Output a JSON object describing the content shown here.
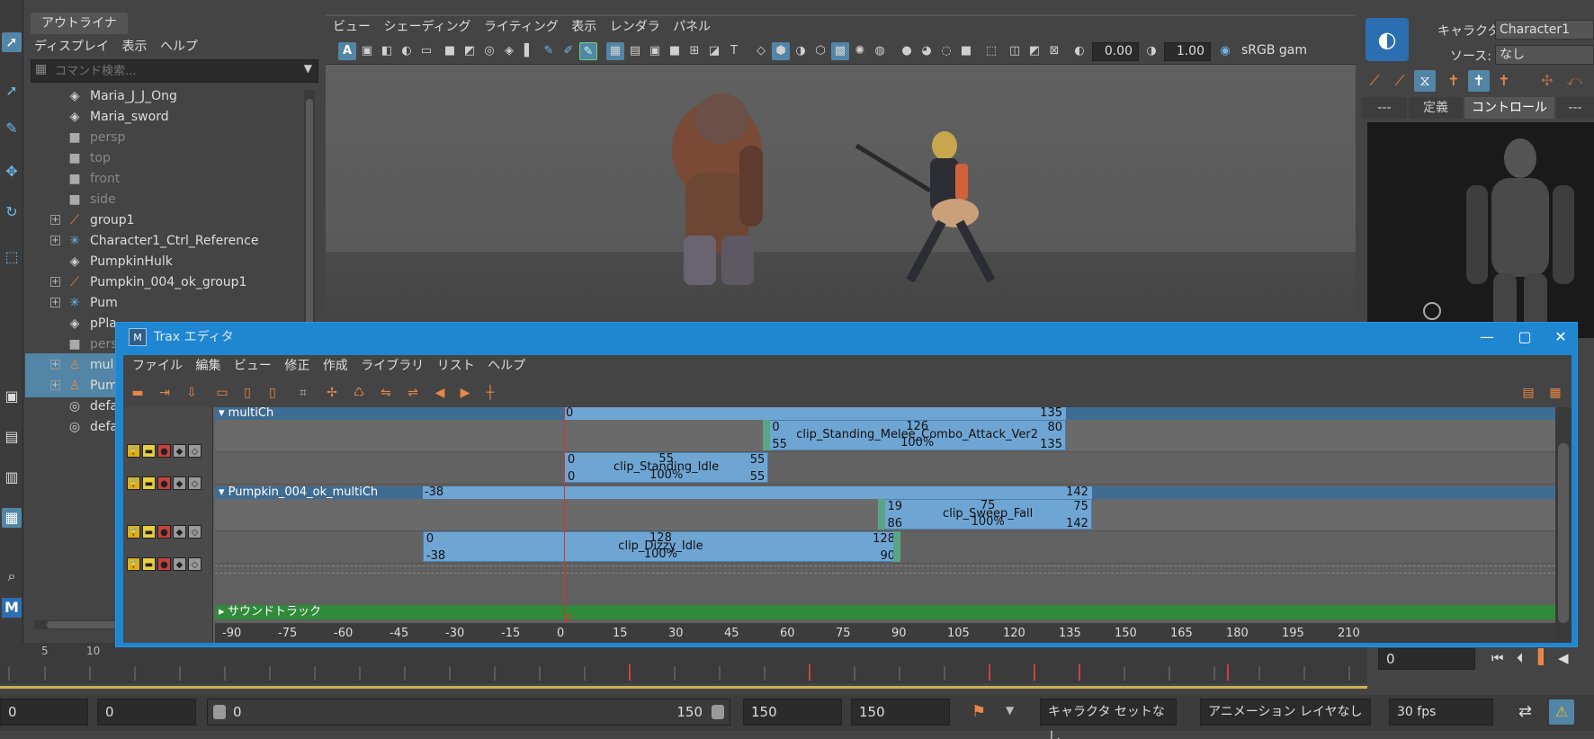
{
  "outliner": {
    "tab_label": "アウトライナ",
    "menu": [
      "ディスプレイ",
      "表示",
      "ヘルプ"
    ],
    "search_placeholder": "コマンド検索...",
    "items": [
      {
        "label": "Maria_J_J_Ong",
        "icon": "mesh-icon",
        "expandable": false,
        "dim": false,
        "selected": false
      },
      {
        "label": "Maria_sword",
        "icon": "mesh-icon",
        "expandable": false,
        "dim": false,
        "selected": false
      },
      {
        "label": "persp",
        "icon": "camera-icon",
        "expandable": false,
        "dim": true,
        "selected": false
      },
      {
        "label": "top",
        "icon": "camera-icon",
        "expandable": false,
        "dim": true,
        "selected": false
      },
      {
        "label": "front",
        "icon": "camera-icon",
        "expandable": false,
        "dim": true,
        "selected": false
      },
      {
        "label": "side",
        "icon": "camera-icon",
        "expandable": false,
        "dim": true,
        "selected": false
      },
      {
        "label": "group1",
        "icon": "group-icon",
        "expandable": true,
        "dim": false,
        "selected": false
      },
      {
        "label": "Character1_Ctrl_Reference",
        "icon": "joint-icon",
        "expandable": true,
        "dim": false,
        "selected": false
      },
      {
        "label": "PumpkinHulk",
        "icon": "mesh-icon",
        "expandable": false,
        "dim": false,
        "selected": false
      },
      {
        "label": "Pumpkin_004_ok_group1",
        "icon": "group-icon",
        "expandable": true,
        "dim": false,
        "selected": false
      },
      {
        "label": "Pum",
        "icon": "joint-icon",
        "expandable": true,
        "dim": false,
        "selected": false
      },
      {
        "label": "pPla",
        "icon": "mesh-icon",
        "expandable": false,
        "dim": false,
        "selected": false
      },
      {
        "label": "pers",
        "icon": "camera-icon",
        "expandable": false,
        "dim": true,
        "selected": false
      },
      {
        "label": "mul",
        "icon": "character-icon",
        "expandable": true,
        "dim": false,
        "selected": true
      },
      {
        "label": "Pum",
        "icon": "character-icon",
        "expandable": true,
        "dim": false,
        "selected": true
      },
      {
        "label": "defa",
        "icon": "set-icon",
        "expandable": false,
        "dim": false,
        "selected": false
      },
      {
        "label": "defa",
        "icon": "set-icon",
        "expandable": false,
        "dim": false,
        "selected": false
      }
    ]
  },
  "viewport": {
    "menu": [
      "ビュー",
      "シェーディング",
      "ライティング",
      "表示",
      "レンダラ",
      "パネル"
    ],
    "exposure": "0.00",
    "gamma": "1.00",
    "color_space": "sRGB gam"
  },
  "charpanel": {
    "character_label": "キャラクタ:",
    "character_value": "Character1",
    "source_label": "ソース:",
    "source_value": "なし",
    "tabs": [
      "---",
      "定義",
      "コントロール",
      "---"
    ]
  },
  "trax": {
    "title": "Trax エディタ",
    "menu": [
      "ファイル",
      "編集",
      "ビュー",
      "修正",
      "作成",
      "ライブラリ",
      "リスト",
      "ヘルプ"
    ],
    "characters": [
      {
        "name": "multiCh",
        "range_start": "0",
        "range_end": "135"
      },
      {
        "name": "Pumpkin_004_ok_multiCh",
        "range_start": "-38",
        "range_end": "142"
      }
    ],
    "clips": [
      {
        "name": "clip_Standing_Melee_Combo_Attack_Ver2",
        "top_left": "0",
        "top_center": "126",
        "top_right": "80",
        "bottom_left": "55",
        "bottom_right": "135",
        "weight": "100%"
      },
      {
        "name": "clip_Standing_Idle",
        "top_left": "0",
        "top_center": "55",
        "top_right": "55",
        "bottom_left": "0",
        "bottom_right": "55",
        "weight": "100%"
      },
      {
        "name": "clip_Sweep_Fall",
        "top_left": "19",
        "top_center": "75",
        "top_right": "75",
        "bottom_left": "86",
        "bottom_right": "142",
        "weight": "100%"
      },
      {
        "name": "clip_Dizzy_Idle",
        "top_left": "0",
        "top_center": "128",
        "top_right": "128",
        "bottom_left": "-38",
        "bottom_right": "90",
        "weight": "100%"
      }
    ],
    "sound_track": "サウンドトラック",
    "current_time": "0",
    "ruler": [
      "-90",
      "-75",
      "-60",
      "-45",
      "-30",
      "-15",
      "0",
      "15",
      "30",
      "45",
      "60",
      "75",
      "90",
      "105",
      "120",
      "135",
      "150",
      "165",
      "180",
      "195",
      "210"
    ]
  },
  "timeslider": {
    "ticks": [
      "5",
      "10"
    ],
    "current_frame": "0"
  },
  "rangebar": {
    "start_field": "0",
    "anim_start": "0",
    "slider_start": "0",
    "slider_end": "150",
    "range_end": "150",
    "anim_end": "150",
    "character_set": "キャラクタ セットなし",
    "anim_layer": "アニメーション レイヤなし",
    "fps": "30 fps"
  }
}
